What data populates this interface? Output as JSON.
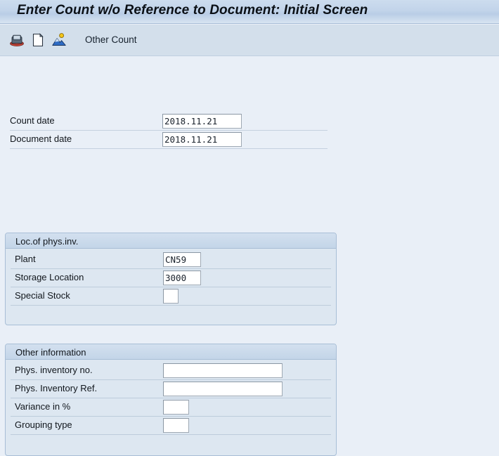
{
  "window": {
    "title": "Enter Count w/o Reference to Document: Initial Screen"
  },
  "toolbar": {
    "icons": [
      {
        "name": "save-icon",
        "title": "Save"
      },
      {
        "name": "new-document-icon",
        "title": "Create New"
      },
      {
        "name": "picture-icon",
        "title": "Display Picture"
      }
    ],
    "other_count_label": "Other Count"
  },
  "form": {
    "top_fields": [
      {
        "label": "Count date",
        "value": "2018.11.21",
        "size": "date"
      },
      {
        "label": "Document date",
        "value": "2018.11.21",
        "size": "date"
      }
    ],
    "groups": [
      {
        "title": "Loc.of phys.inv.",
        "fields": [
          {
            "label": "Plant",
            "value": "CN59",
            "size": "small"
          },
          {
            "label": "Storage Location",
            "value": "3000",
            "size": "small"
          },
          {
            "label": "Special Stock",
            "value": "",
            "size": "tiny"
          }
        ]
      },
      {
        "title": "Other information",
        "fields": [
          {
            "label": "Phys. inventory no.",
            "value": "",
            "size": "wide"
          },
          {
            "label": "Phys. Inventory Ref.",
            "value": "",
            "size": "wide"
          },
          {
            "label": "Variance in %",
            "value": "",
            "size": "tiny2"
          },
          {
            "label": "Grouping type",
            "value": "",
            "size": "tiny2"
          }
        ]
      }
    ]
  },
  "colors": {
    "page_background": "#e9eff7",
    "titlebar_gradient_top": "#ccdcee",
    "titlebar_gradient_bottom": "#d8e4f1",
    "toolbar_background": "#d3dfeb",
    "group_background": "#dde7f1",
    "group_header_background": "#c8d9ea",
    "group_border": "#a8bed6",
    "field_background": "#ffffff",
    "field_border": "#9fa9b4",
    "text": "#11161c"
  }
}
